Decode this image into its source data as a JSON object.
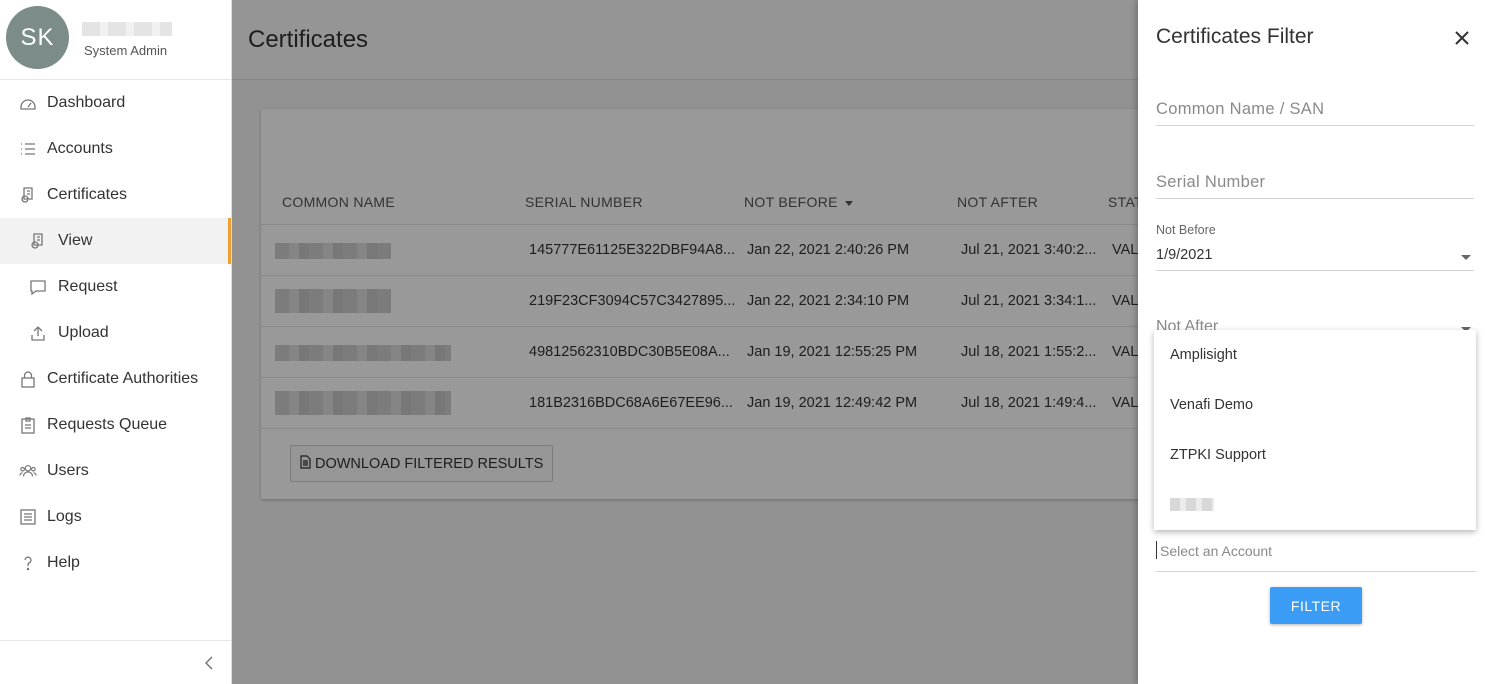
{
  "sidebar": {
    "avatar_initials": "SK",
    "user_role": "System Admin",
    "items": [
      {
        "label": "Dashboard",
        "icon": "dashboard-icon"
      },
      {
        "label": "Accounts",
        "icon": "list-icon"
      },
      {
        "label": "Certificates",
        "icon": "certificate-icon"
      },
      {
        "label": "View",
        "icon": "certificate-view-icon"
      },
      {
        "label": "Request",
        "icon": "comment-icon"
      },
      {
        "label": "Upload",
        "icon": "upload-icon"
      },
      {
        "label": "Certificate Authorities",
        "icon": "lock-icon"
      },
      {
        "label": "Requests Queue",
        "icon": "clipboard-icon"
      },
      {
        "label": "Users",
        "icon": "users-icon"
      },
      {
        "label": "Logs",
        "icon": "logs-icon"
      },
      {
        "label": "Help",
        "icon": "help-icon"
      }
    ],
    "active_item": "View",
    "accent_color": "#f0a030"
  },
  "main": {
    "title": "Certificates",
    "table": {
      "columns": [
        "COMMON NAME",
        "SERIAL NUMBER",
        "NOT BEFORE",
        "NOT AFTER",
        "STAT"
      ],
      "rows": [
        {
          "serial": "145777E61125E322DBF94A8...",
          "not_before": "Jan 22, 2021 2:40:26 PM",
          "not_after": "Jul 21, 2021 3:40:2...",
          "status": "VAL"
        },
        {
          "serial": "219F23CF3094C57C3427895...",
          "not_before": "Jan 22, 2021 2:34:10 PM",
          "not_after": "Jul 21, 2021 3:34:1...",
          "status": "VAL"
        },
        {
          "serial": "49812562310BDC30B5E08A...",
          "not_before": "Jan 19, 2021 12:55:25 PM",
          "not_after": "Jul 18, 2021 1:55:2...",
          "status": "VAL"
        },
        {
          "serial": "181B2316BDC68A6E67EE96...",
          "not_before": "Jan 19, 2021 12:49:42 PM",
          "not_after": "Jul 18, 2021 1:49:4...",
          "status": "VAL"
        }
      ]
    },
    "download_label": "DOWNLOAD FILTERED RESULTS"
  },
  "filter_panel": {
    "title": "Certificates Filter",
    "common_name_placeholder": "Common Name / SAN",
    "serial_placeholder": "Serial Number",
    "not_before_label": "Not Before",
    "not_before_value": "1/9/2021",
    "not_after_label": "Not After",
    "account_options": [
      "Amplisight",
      "Venafi Demo",
      "ZTPKI Support"
    ],
    "account_placeholder": "Select an Account",
    "filter_label": "FILTER",
    "button_color": "#3a9cf4"
  }
}
